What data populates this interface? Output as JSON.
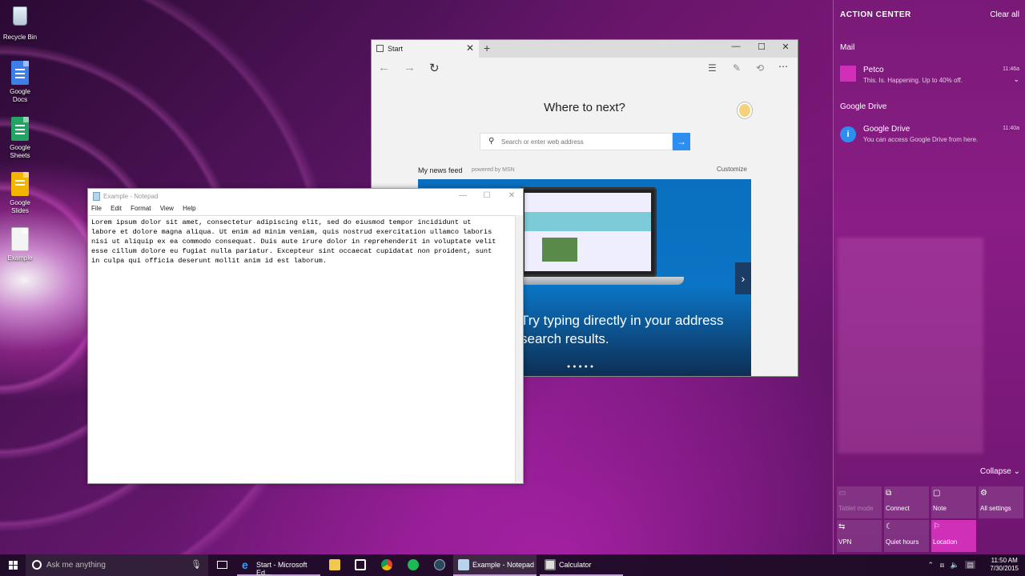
{
  "desktop": {
    "icons": [
      {
        "label": "Recycle Bin"
      },
      {
        "label": "Google Docs"
      },
      {
        "label": "Google Sheets"
      },
      {
        "label": "Google Slides"
      },
      {
        "label": "Example"
      }
    ]
  },
  "edge": {
    "tab_label": "Start",
    "tab_close": "✕",
    "new_tab": "+",
    "heading": "Where to next?",
    "search_placeholder": "Search or enter web address",
    "feed_title": "My news feed",
    "feed_sub": "powered by MSN",
    "customize": "Customize",
    "hero_text_line1": "Try typing directly in your address",
    "hero_text_line2": "search results.",
    "hero_dots": "●●●●●"
  },
  "notepad": {
    "title": "Example - Notepad",
    "menu": [
      "File",
      "Edit",
      "Format",
      "View",
      "Help"
    ],
    "text": "Lorem ipsum dolor sit amet, consectetur adipiscing elit, sed do eiusmod tempor incididunt ut\nlabore et dolore magna aliqua. Ut enim ad minim veniam, quis nostrud exercitation ullamco laboris\nnisi ut aliquip ex ea commodo consequat. Duis aute irure dolor in reprehenderit in voluptate velit\nesse cillum dolore eu fugiat nulla pariatur. Excepteur sint occaecat cupidatat non proident, sunt\nin culpa qui officia deserunt mollit anim id est laborum."
  },
  "action_center": {
    "header": "ACTION CENTER",
    "clear_all": "Clear all",
    "sections": [
      {
        "name": "Mail",
        "notification": {
          "title": "Petco",
          "body": "This. Is. Happening. Up to 40% off.",
          "time": "11:46a"
        }
      },
      {
        "name": "Google Drive",
        "notification": {
          "title": "Google Drive",
          "body": "You can access Google Drive from here.",
          "time": "11:40a"
        }
      }
    ],
    "collapse": "Collapse",
    "tiles": [
      {
        "label": "Tablet mode",
        "icon": "tablet-icon",
        "state": "disabled"
      },
      {
        "label": "Connect",
        "icon": "connect-icon",
        "state": "normal"
      },
      {
        "label": "Note",
        "icon": "note-icon",
        "state": "normal"
      },
      {
        "label": "All settings",
        "icon": "gear-icon",
        "state": "normal"
      },
      {
        "label": "VPN",
        "icon": "vpn-icon",
        "state": "normal"
      },
      {
        "label": "Quiet hours",
        "icon": "moon-icon",
        "state": "normal"
      },
      {
        "label": "Location",
        "icon": "location-icon",
        "state": "active"
      }
    ]
  },
  "taskbar": {
    "search_placeholder": "Ask me anything",
    "items": [
      {
        "label": "Start - Microsoft Ed..."
      },
      {
        "label": "Example - Notepad"
      },
      {
        "label": "Calculator"
      }
    ],
    "time": "11:50 AM",
    "date": "7/30/2015"
  },
  "colors": {
    "edge_accent": "#2d8ef0",
    "action_center_bg": "#7a1a78",
    "tile_active": "#d02fb8"
  }
}
